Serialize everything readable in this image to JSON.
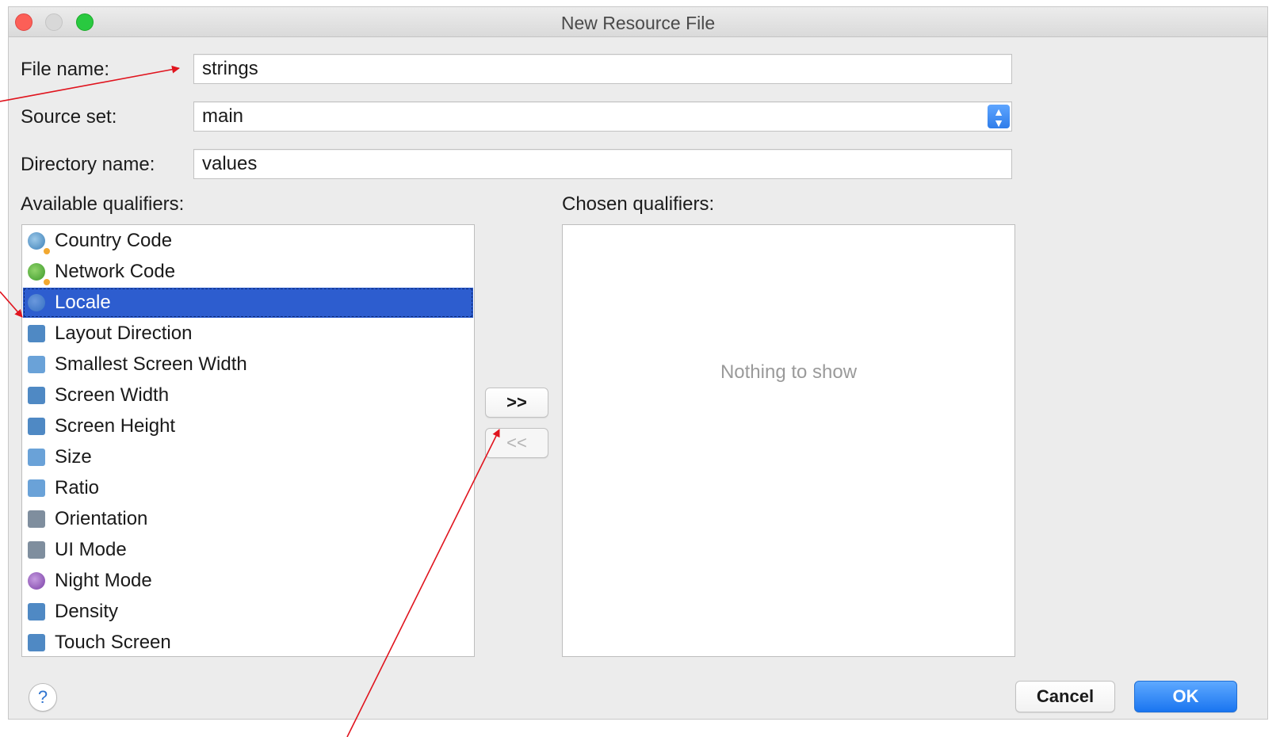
{
  "window": {
    "title": "New Resource File"
  },
  "form": {
    "file_name_label": "File name:",
    "file_name_value": "strings",
    "source_set_label": "Source set:",
    "source_set_value": "main",
    "directory_name_label": "Directory name:",
    "directory_name_value": "values"
  },
  "available": {
    "label": "Available qualifiers:",
    "items": [
      {
        "label": "Country Code",
        "icon": "globe-icon",
        "selected": false
      },
      {
        "label": "Network Code",
        "icon": "network-icon",
        "selected": false
      },
      {
        "label": "Locale",
        "icon": "globe-icon",
        "selected": true
      },
      {
        "label": "Layout Direction",
        "icon": "layout-direction-icon",
        "selected": false
      },
      {
        "label": "Smallest Screen Width",
        "icon": "smallest-width-icon",
        "selected": false
      },
      {
        "label": "Screen Width",
        "icon": "screen-width-icon",
        "selected": false
      },
      {
        "label": "Screen Height",
        "icon": "screen-height-icon",
        "selected": false
      },
      {
        "label": "Size",
        "icon": "size-icon",
        "selected": false
      },
      {
        "label": "Ratio",
        "icon": "ratio-icon",
        "selected": false
      },
      {
        "label": "Orientation",
        "icon": "orientation-icon",
        "selected": false
      },
      {
        "label": "UI Mode",
        "icon": "ui-mode-icon",
        "selected": false
      },
      {
        "label": "Night Mode",
        "icon": "night-mode-icon",
        "selected": false
      },
      {
        "label": "Density",
        "icon": "density-icon",
        "selected": false
      },
      {
        "label": "Touch Screen",
        "icon": "touch-screen-icon",
        "selected": false
      }
    ]
  },
  "chosen": {
    "label": "Chosen qualifiers:",
    "empty_text": "Nothing to show"
  },
  "transfer": {
    "add_label": ">>",
    "remove_label": "<<"
  },
  "footer": {
    "help_label": "?",
    "cancel_label": "Cancel",
    "ok_label": "OK"
  },
  "colors": {
    "selection": "#2d5dcf",
    "primary_button": "#1a75f0",
    "annotation_arrow": "#e0141e"
  }
}
